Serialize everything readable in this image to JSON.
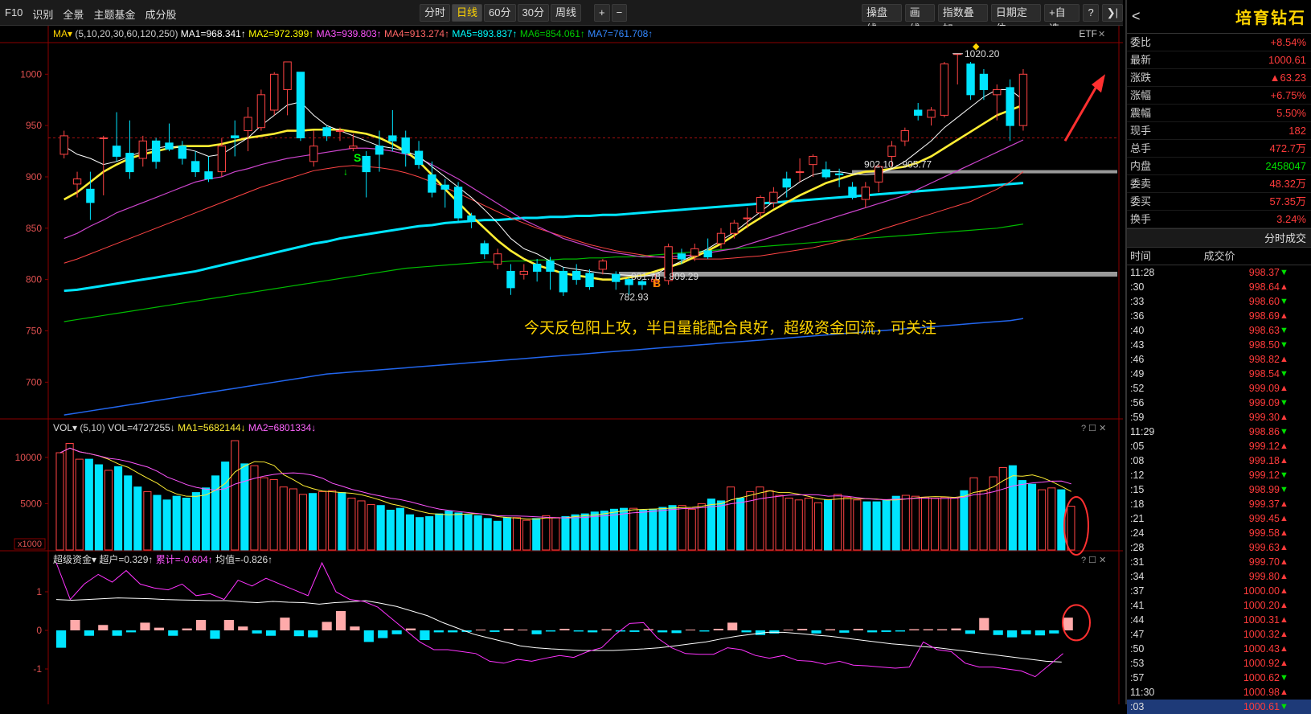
{
  "toolbar": {
    "left": [
      "F10",
      "识别",
      "全景",
      "主题基金",
      "成分股"
    ],
    "periods": [
      "分时",
      "日线",
      "60分",
      "30分",
      "周线"
    ],
    "active": "日线",
    "plus": "+",
    "minus": "−",
    "right": [
      "操盘线",
      "画线",
      "指数叠加",
      "日期定位",
      "+自选"
    ],
    "help": "?",
    "nav": "❯|"
  },
  "main": {
    "ind_name": "MA",
    "ind_params": "(5,10,20,30,60,120,250)",
    "ma": [
      "MA1=968.341↑",
      "MA2=972.399↑",
      "MA3=939.803↑",
      "MA4=913.274↑",
      "MA5=893.837↑",
      "MA6=854.061↑",
      "MA7=761.708↑"
    ],
    "ma_colors": [
      "#ffffff",
      "#ffff00",
      "#ff55ff",
      "#ff6666",
      "#00ffff",
      "#00cc00",
      "#3388ff"
    ],
    "etf": "ETF",
    "yticks": [
      "1000",
      "950",
      "900",
      "850",
      "800",
      "750",
      "700"
    ],
    "ann_high": "1020.20",
    "ann_low": "782.93",
    "ann_band1": "902.10 - 905.77",
    "ann_band2": "801.78 - 809.29",
    "sig_s": "S",
    "sig_b": "B",
    "note": "今天反包阳上攻，半日量能配合良好，超级资金回流，可关注"
  },
  "vol": {
    "name": "VOL",
    "params": "(5,10)",
    "vals": [
      "VOL=4727255↓",
      "MA1=5682144↓",
      "MA2=6801334↓"
    ],
    "yticks": [
      "10000",
      "5000"
    ],
    "unit": "x1000"
  },
  "fund": {
    "name": "超级资金",
    "vals": [
      "超户=0.329↑",
      "累计=-0.604↑",
      "均值=-0.826↑"
    ],
    "yticks": [
      "1",
      "0",
      "-1"
    ]
  },
  "quote": {
    "name": "培育钻石",
    "back": "<",
    "rows": [
      [
        "委比",
        "+8.54%",
        "red"
      ],
      [
        "最新",
        "1000.61",
        "red"
      ],
      [
        "涨跌",
        "▲63.23",
        "red"
      ],
      [
        "涨幅",
        "+6.75%",
        "red"
      ],
      [
        "震幅",
        "5.50%",
        "red"
      ],
      [
        "现手",
        "182",
        "red"
      ],
      [
        "总手",
        "472.7万",
        "red"
      ],
      [
        "内盘",
        "2458047",
        "green"
      ],
      [
        "委卖",
        "48.32万",
        "red"
      ],
      [
        "委买",
        "57.35万",
        "red"
      ],
      [
        "换手",
        "3.24%",
        "red"
      ]
    ]
  },
  "ticks": {
    "title": "分时成交",
    "col_time": "时间",
    "col_price": "成交价",
    "rows": [
      [
        "11:28",
        "998.37",
        "d"
      ],
      [
        ":30",
        "998.64",
        "u"
      ],
      [
        ":33",
        "998.60",
        "d"
      ],
      [
        ":36",
        "998.69",
        "u"
      ],
      [
        ":40",
        "998.63",
        "d"
      ],
      [
        ":43",
        "998.50",
        "d"
      ],
      [
        ":46",
        "998.82",
        "u"
      ],
      [
        ":49",
        "998.54",
        "d"
      ],
      [
        ":52",
        "999.09",
        "u"
      ],
      [
        ":56",
        "999.09",
        "d"
      ],
      [
        ":59",
        "999.30",
        "u"
      ],
      [
        "11:29",
        "998.86",
        "d"
      ],
      [
        ":05",
        "999.12",
        "u"
      ],
      [
        ":08",
        "999.18",
        "u"
      ],
      [
        ":12",
        "999.12",
        "d"
      ],
      [
        ":15",
        "998.99",
        "d"
      ],
      [
        ":18",
        "999.37",
        "u"
      ],
      [
        ":21",
        "999.45",
        "u"
      ],
      [
        ":24",
        "999.58",
        "u"
      ],
      [
        ":28",
        "999.63",
        "u"
      ],
      [
        ":31",
        "999.70",
        "u"
      ],
      [
        ":34",
        "999.80",
        "u"
      ],
      [
        ":37",
        "1000.00",
        "u"
      ],
      [
        ":41",
        "1000.20",
        "u"
      ],
      [
        ":44",
        "1000.31",
        "u"
      ],
      [
        ":47",
        "1000.32",
        "u"
      ],
      [
        ":50",
        "1000.43",
        "u"
      ],
      [
        ":53",
        "1000.92",
        "u"
      ],
      [
        ":57",
        "1000.62",
        "d"
      ],
      [
        "11:30",
        "1000.98",
        "u"
      ],
      [
        ":03",
        "1000.61",
        "d"
      ]
    ]
  },
  "chart_data": {
    "type": "candlestick",
    "ylim": [
      665,
      1030
    ],
    "candles": [
      [
        922,
        940,
        945,
        918
      ],
      [
        893,
        898,
        905,
        880
      ],
      [
        888,
        875,
        905,
        858
      ],
      [
        938,
        938,
        940,
        882
      ],
      [
        930,
        920,
        963,
        915
      ],
      [
        923,
        905,
        955,
        898
      ],
      [
        918,
        935,
        940,
        910
      ],
      [
        935,
        915,
        938,
        908
      ],
      [
        933,
        927,
        952,
        925
      ],
      [
        930,
        918,
        935,
        912
      ],
      [
        915,
        905,
        925,
        900
      ],
      [
        905,
        898,
        920,
        895
      ],
      [
        905,
        930,
        938,
        900
      ],
      [
        940,
        938,
        955,
        920
      ],
      [
        945,
        958,
        968,
        925
      ],
      [
        948,
        980,
        985,
        945
      ],
      [
        965,
        1000,
        1002,
        960
      ],
      [
        985,
        1012,
        1012,
        960
      ],
      [
        1002,
        938,
        1002,
        935
      ],
      [
        915,
        930,
        945,
        910
      ],
      [
        948,
        940,
        950,
        935
      ],
      [
        945,
        945,
        948,
        935
      ],
      [
        928,
        930,
        942,
        925
      ],
      [
        920,
        905,
        925,
        880
      ],
      [
        930,
        922,
        945,
        905
      ],
      [
        940,
        935,
        965,
        925
      ],
      [
        938,
        923,
        945,
        910
      ],
      [
        925,
        912,
        935,
        908
      ],
      [
        902,
        885,
        915,
        880
      ],
      [
        892,
        888,
        898,
        870
      ],
      [
        890,
        860,
        895,
        855
      ],
      [
        862,
        858,
        865,
        850
      ],
      [
        835,
        825,
        838,
        820
      ],
      [
        815,
        825,
        830,
        810
      ],
      [
        808,
        792,
        815,
        785
      ],
      [
        805,
        808,
        815,
        800
      ],
      [
        815,
        808,
        820,
        798
      ],
      [
        818,
        808,
        822,
        790
      ],
      [
        808,
        788,
        812,
        784
      ],
      [
        808,
        800,
        815,
        795
      ],
      [
        806,
        793,
        810,
        790
      ],
      [
        810,
        818,
        820,
        805
      ],
      [
        805,
        798,
        808,
        790
      ],
      [
        800,
        795,
        802,
        785
      ],
      [
        798,
        795,
        800,
        790
      ],
      [
        798,
        800,
        805,
        793
      ],
      [
        799,
        832,
        835,
        795
      ],
      [
        825,
        820,
        830,
        815
      ],
      [
        823,
        830,
        835,
        818
      ],
      [
        828,
        822,
        840,
        820
      ],
      [
        835,
        845,
        850,
        830
      ],
      [
        845,
        855,
        858,
        840
      ],
      [
        860,
        860,
        870,
        850
      ],
      [
        865,
        880,
        882,
        860
      ],
      [
        875,
        885,
        890,
        870
      ],
      [
        898,
        890,
        905,
        880
      ],
      [
        905,
        905,
        918,
        895
      ],
      [
        912,
        920,
        922,
        900
      ],
      [
        907,
        900,
        915,
        898
      ],
      [
        903,
        902,
        908,
        890
      ],
      [
        890,
        880,
        895,
        878
      ],
      [
        878,
        890,
        895,
        870
      ],
      [
        895,
        910,
        912,
        885
      ],
      [
        920,
        930,
        935,
        910
      ],
      [
        935,
        945,
        948,
        930
      ],
      [
        965,
        960,
        972,
        955
      ],
      [
        958,
        965,
        968,
        950
      ],
      [
        960,
        1010,
        1012,
        958
      ],
      [
        1020,
        1020,
        1020,
        990
      ],
      [
        1010,
        980,
        1012,
        975
      ],
      [
        1000,
        985,
        1005,
        975
      ],
      [
        980,
        985,
        990,
        955
      ],
      [
        987,
        950,
        995,
        935
      ],
      [
        950,
        1000,
        1005,
        945
      ]
    ],
    "ma5": [
      930,
      922,
      918,
      912,
      915,
      920,
      925,
      928,
      930,
      928,
      925,
      920,
      922,
      930,
      938,
      950,
      960,
      970,
      973,
      960,
      950,
      945,
      940,
      935,
      930,
      928,
      925,
      920,
      910,
      900,
      890,
      880,
      868,
      855,
      840,
      830,
      825,
      818,
      812,
      810,
      808,
      806,
      805,
      804,
      803,
      805,
      812,
      818,
      824,
      830,
      838,
      846,
      856,
      866,
      876,
      886,
      895,
      902,
      905,
      905,
      903,
      902,
      903,
      908,
      915,
      925,
      935,
      948,
      958,
      968,
      978,
      985,
      985,
      975
    ],
    "ma10": [
      878,
      885,
      895,
      905,
      912,
      918,
      922,
      925,
      928,
      930,
      930,
      930,
      932,
      935,
      938,
      940,
      942,
      945,
      945,
      946,
      946,
      946,
      944,
      942,
      938,
      932,
      925,
      915,
      902,
      888,
      875,
      862,
      850,
      838,
      828,
      820,
      814,
      810,
      806,
      804,
      802,
      800,
      800,
      802,
      804,
      808,
      812,
      816,
      822,
      828,
      835,
      843,
      852,
      860,
      868,
      875,
      882,
      888,
      894,
      898,
      902,
      905,
      906,
      908,
      910,
      914,
      920,
      928,
      936,
      944,
      952,
      960,
      965,
      970
    ],
    "ma20": [
      840,
      845,
      852,
      858,
      865,
      870,
      875,
      880,
      885,
      890,
      895,
      898,
      900,
      905,
      908,
      912,
      915,
      918,
      920,
      922,
      924,
      926,
      928,
      928,
      927,
      925,
      922,
      918,
      912,
      905,
      898,
      890,
      882,
      874,
      866,
      858,
      852,
      846,
      840,
      836,
      832,
      828,
      826,
      824,
      822,
      822,
      822,
      823,
      824,
      826,
      828,
      830,
      834,
      838,
      842,
      846,
      850,
      854,
      858,
      862,
      866,
      870,
      874,
      878,
      882,
      888,
      894,
      900,
      906,
      912,
      918,
      924,
      930,
      936
    ],
    "ma30": [
      816,
      820,
      825,
      830,
      835,
      840,
      845,
      850,
      855,
      860,
      865,
      870,
      875,
      880,
      885,
      890,
      894,
      898,
      902,
      906,
      908,
      910,
      911,
      910,
      909,
      907,
      904,
      900,
      895,
      890,
      884,
      878,
      872,
      866,
      860,
      855,
      850,
      846,
      842,
      838,
      834,
      831,
      828,
      826,
      824,
      822,
      821,
      820,
      820,
      820,
      820,
      821,
      822,
      823,
      825,
      827,
      829,
      831,
      834,
      837,
      840,
      844,
      848,
      852,
      856,
      860,
      864,
      868,
      872,
      876,
      882,
      888,
      895,
      905
    ],
    "ma60": [
      789,
      790,
      792,
      794,
      796,
      798,
      800,
      802,
      804,
      806,
      808,
      811,
      814,
      817,
      820,
      823,
      826,
      829,
      832,
      835,
      837,
      840,
      842,
      844,
      846,
      848,
      850,
      852,
      853,
      855,
      856,
      857,
      858,
      858,
      859,
      860,
      860,
      861,
      861,
      862,
      862,
      863,
      863,
      864,
      865,
      866,
      867,
      868,
      869,
      870,
      871,
      872,
      873,
      874,
      875,
      876,
      877,
      878,
      879,
      880,
      881,
      882,
      883,
      884,
      885,
      886,
      887,
      888,
      889,
      890,
      891,
      892,
      893,
      894
    ],
    "ma120": [
      759,
      761,
      763,
      765,
      767,
      769,
      771,
      773,
      775,
      777,
      779,
      781,
      783,
      785,
      787,
      789,
      791,
      793,
      795,
      797,
      799,
      801,
      803,
      805,
      807,
      809,
      811,
      812,
      813,
      814,
      815,
      816,
      817,
      817,
      818,
      818,
      819,
      819,
      820,
      820,
      821,
      821,
      822,
      822,
      823,
      824,
      825,
      826,
      827,
      828,
      829,
      830,
      831,
      832,
      833,
      834,
      835,
      836,
      837,
      838,
      839,
      840,
      841,
      842,
      843,
      844,
      845,
      846,
      847,
      848,
      849,
      850,
      852,
      854
    ],
    "ma250": [
      668,
      670,
      672,
      674,
      676,
      678,
      680,
      682,
      684,
      686,
      688,
      690,
      692,
      694,
      696,
      698,
      700,
      702,
      704,
      706,
      708,
      709,
      710,
      711,
      712,
      713,
      714,
      715,
      716,
      717,
      718,
      719,
      720,
      721,
      722,
      723,
      724,
      725,
      726,
      727,
      728,
      729,
      730,
      731,
      732,
      733,
      734,
      735,
      736,
      737,
      738,
      739,
      740,
      741,
      742,
      743,
      744,
      745,
      746,
      747,
      748,
      749,
      750,
      751,
      752,
      753,
      754,
      755,
      756,
      757,
      758,
      759,
      760,
      762
    ],
    "volume": [
      10500,
      11500,
      9800,
      9800,
      9200,
      8600,
      9000,
      8000,
      6800,
      6300,
      5900,
      5400,
      5800,
      5600,
      6200,
      6700,
      8000,
      9500,
      11800,
      9300,
      9100,
      7800,
      7600,
      6800,
      6600,
      6000,
      6100,
      6300,
      6400,
      6200,
      5600,
      5300,
      4900,
      4800,
      4300,
      4500,
      3800,
      3500,
      3600,
      3900,
      4200,
      4000,
      3800,
      3700,
      3400,
      3100,
      3500,
      3500,
      3200,
      3400,
      3700,
      3500,
      3600,
      3800,
      3900,
      4100,
      4200,
      4400,
      4500,
      4500,
      4300,
      4400,
      4600,
      4800,
      4800,
      4400,
      5000,
      5500,
      5300,
      6800,
      5600,
      6300,
      6800,
      6400,
      5900,
      5600,
      5400,
      5600,
      5100,
      5400,
      6000,
      5700,
      5400,
      5200,
      5200,
      5400,
      5800,
      5900,
      5800,
      5700,
      5600,
      5700,
      5600,
      6400,
      7800,
      6400,
      7900,
      8900,
      9100,
      7500,
      7100,
      6500,
      6700,
      6500,
      4727
    ],
    "fund_bar": [
      -0.45,
      0.27,
      -0.14,
      0.14,
      -0.14,
      -0.05,
      0.2,
      0.07,
      -0.14,
      0.05,
      0.27,
      -0.22,
      0.27,
      0.1,
      -0.08,
      -0.14,
      0.33,
      -0.15,
      -0.18,
      0.22,
      0.5,
      0.1,
      -0.3,
      -0.2,
      -0.1,
      0.05,
      -0.25,
      -0.05,
      -0.05,
      -0.04,
      0.02,
      -0.04,
      0.04,
      0.02,
      -0.1,
      -0.03,
      0.04,
      -0.03,
      -0.05,
      0.03,
      -0.03,
      -0.04,
      0.03,
      -0.05,
      -0.07,
      0.02,
      -0.03,
      0.04,
      0.2,
      -0.05,
      -0.12,
      -0.08,
      0.02,
      0.04,
      -0.08,
      0.03,
      -0.06,
      0.04,
      -0.05,
      -0.04,
      -0.03,
      0.03,
      0.03,
      0.03,
      0.05,
      -0.09,
      0.32,
      -0.12,
      -0.18,
      -0.1,
      -0.13,
      -0.08,
      0.33
    ],
    "fund_white": [
      0.8,
      0.78,
      0.8,
      0.82,
      0.84,
      0.83,
      0.82,
      0.8,
      0.79,
      0.78,
      0.77,
      0.77,
      0.74,
      0.72,
      0.75,
      0.73,
      0.72,
      0.68,
      0.72,
      0.74,
      0.77,
      0.7,
      0.62,
      0.5,
      0.38,
      0.2,
      0.05,
      -0.1,
      -0.2,
      -0.3,
      -0.4,
      -0.45,
      -0.48,
      -0.5,
      -0.52,
      -0.52,
      -0.52,
      -0.5,
      -0.48,
      -0.45,
      -0.4,
      -0.35,
      -0.3,
      -0.22,
      -0.15,
      -0.1,
      -0.05,
      -0.05,
      -0.08,
      -0.12,
      -0.15,
      -0.2,
      -0.25,
      -0.3,
      -0.35,
      -0.38,
      -0.42,
      -0.45,
      -0.5,
      -0.55,
      -0.6,
      -0.65,
      -0.7,
      -0.75,
      -0.8,
      -0.82
    ],
    "fund_mag": [
      1.75,
      0.8,
      1.2,
      1.45,
      1.25,
      1.55,
      1.2,
      1.1,
      1.05,
      1.2,
      0.9,
      0.95,
      0.8,
      1.3,
      1.15,
      1.35,
      1.2,
      1.05,
      0.9,
      1.75,
      1.0,
      0.8,
      0.75,
      0.6,
      0.3,
      0.0,
      -0.3,
      -0.5,
      -0.5,
      -0.55,
      -0.6,
      -0.8,
      -0.85,
      -0.75,
      -0.8,
      -0.72,
      -0.65,
      -0.7,
      -0.55,
      -0.45,
      -0.1,
      0.18,
      0.2,
      -0.2,
      -0.45,
      -0.6,
      -0.62,
      -0.62,
      -0.45,
      -0.5,
      -0.65,
      -0.72,
      -0.65,
      -0.78,
      -0.8,
      -0.88,
      -0.8,
      -0.9,
      -0.92,
      -0.95,
      -0.98,
      -0.95,
      -0.3,
      -0.5,
      -0.55,
      -0.85,
      -0.95,
      -0.95,
      -1.0,
      -1.05,
      -1.2,
      -0.9,
      -0.6
    ]
  }
}
